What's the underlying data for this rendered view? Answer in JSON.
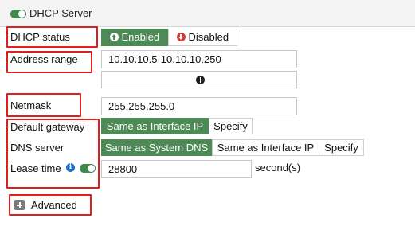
{
  "header": {
    "title": "DHCP Server",
    "enabled": true
  },
  "dhcp_status": {
    "label": "DHCP status",
    "options": [
      {
        "label": "Enabled",
        "icon": "arrow-up-circle-icon",
        "selected": true
      },
      {
        "label": "Disabled",
        "icon": "arrow-down-circle-icon",
        "selected": false
      }
    ]
  },
  "address_range": {
    "label": "Address range",
    "value": "10.10.10.5-10.10.10.250",
    "add_icon": "plus-circle-icon"
  },
  "netmask": {
    "label": "Netmask",
    "value": "255.255.255.0"
  },
  "default_gateway": {
    "label": "Default gateway",
    "options": [
      {
        "label": "Same as Interface IP",
        "selected": true
      },
      {
        "label": "Specify",
        "selected": false
      }
    ]
  },
  "dns_server": {
    "label": "DNS server",
    "options": [
      {
        "label": "Same as System DNS",
        "selected": true
      },
      {
        "label": "Same as Interface IP",
        "selected": false
      },
      {
        "label": "Specify",
        "selected": false
      }
    ]
  },
  "lease_time": {
    "label": "Lease time",
    "info_icon": "info-icon",
    "enabled": true,
    "value": "28800",
    "unit": "second(s)"
  },
  "advanced": {
    "label": "Advanced",
    "icon": "plus-square-icon"
  },
  "colors": {
    "accent": "#4d8a55",
    "annotation": "#e01e1e",
    "disabled_icon": "#d23a35",
    "info": "#1e6fbf"
  }
}
